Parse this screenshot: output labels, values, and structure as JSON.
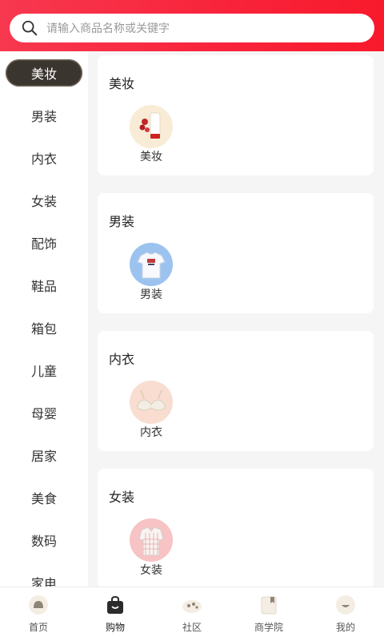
{
  "search": {
    "placeholder": "请输入商品名称或关键字"
  },
  "sidebar": {
    "active_index": 0,
    "items": [
      {
        "label": "美妆"
      },
      {
        "label": "男装"
      },
      {
        "label": "内衣"
      },
      {
        "label": "女装"
      },
      {
        "label": "配饰"
      },
      {
        "label": "鞋品"
      },
      {
        "label": "箱包"
      },
      {
        "label": "儿童"
      },
      {
        "label": "母婴"
      },
      {
        "label": "居家"
      },
      {
        "label": "美食"
      },
      {
        "label": "数码"
      },
      {
        "label": "家电"
      }
    ]
  },
  "sections": [
    {
      "title": "美妆",
      "item_label": "美妆",
      "icon": "cosmetics-icon",
      "bg": "#f8ecd6"
    },
    {
      "title": "男装",
      "item_label": "男装",
      "icon": "tshirt-icon",
      "bg": "#9cc3ef"
    },
    {
      "title": "内衣",
      "item_label": "内衣",
      "icon": "bra-icon",
      "bg": "#f8ddd0"
    },
    {
      "title": "女装",
      "item_label": "女装",
      "icon": "dress-shirt-icon",
      "bg": "#f7c3c4"
    }
  ],
  "tabbar": {
    "active_index": 1,
    "tabs": [
      {
        "label": "首页",
        "icon": "home-icon"
      },
      {
        "label": "购物",
        "icon": "shopping-bag-icon"
      },
      {
        "label": "社区",
        "icon": "community-icon"
      },
      {
        "label": "商学院",
        "icon": "book-icon"
      },
      {
        "label": "我的",
        "icon": "profile-icon"
      }
    ]
  },
  "colors": {
    "header": "#f8233a",
    "active_pill": "#3b3530"
  }
}
